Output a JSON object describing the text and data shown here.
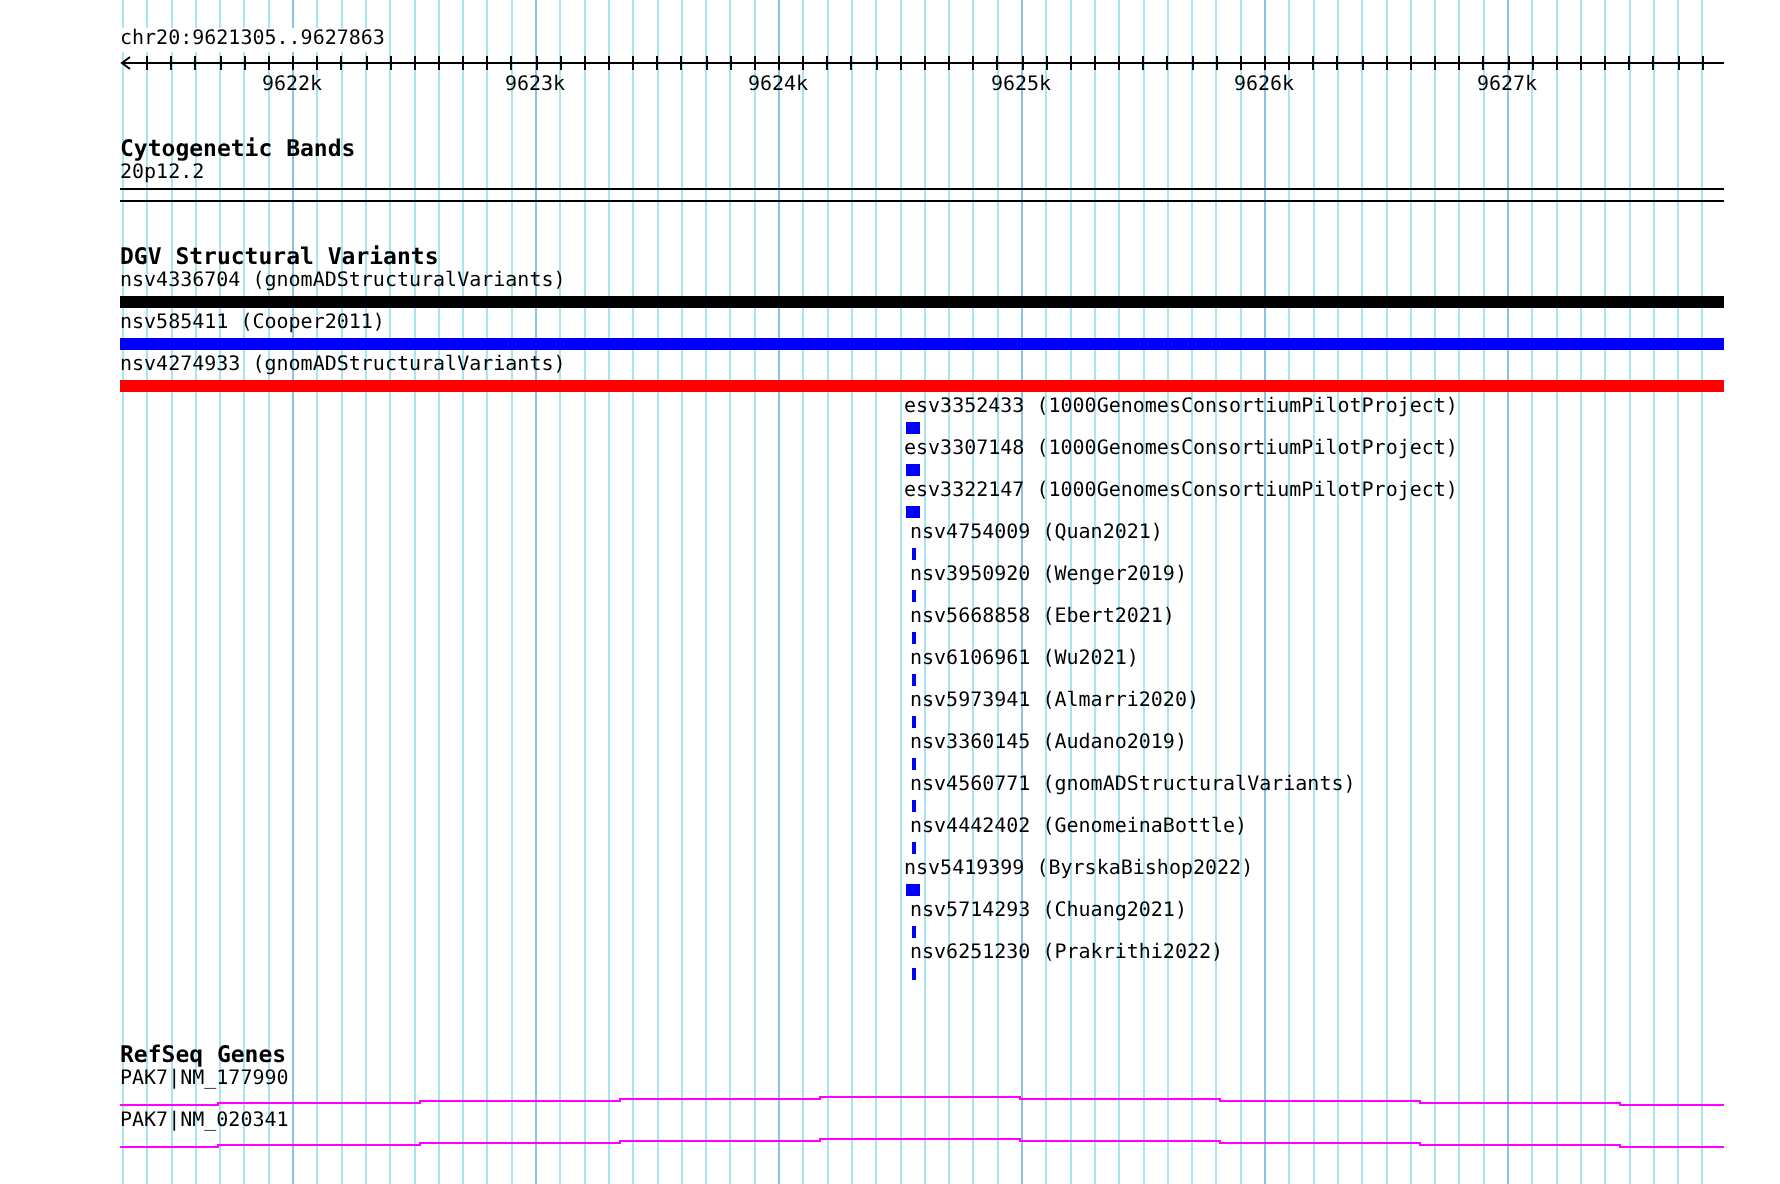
{
  "ruler": {
    "location": "chr20:9621305..9627863",
    "ticks": [
      "9622k",
      "9623k",
      "9624k",
      "9625k",
      "9626k",
      "9627k"
    ]
  },
  "tracks": [
    {
      "title": "Cytogenetic Bands",
      "kind": "band",
      "features": [
        {
          "label": "20p12.2"
        }
      ]
    },
    {
      "title": "DGV Structural Variants",
      "kind": "variants",
      "features": [
        {
          "label": "nsv4336704 (gnomADStructuralVariants)",
          "kind": "span",
          "color": "#000000"
        },
        {
          "label": "nsv585411 (Cooper2011)",
          "kind": "span",
          "color": "#0000ff"
        },
        {
          "label": "nsv4274933 (gnomADStructuralVariants)",
          "kind": "span",
          "color": "#ff0000"
        },
        {
          "label": "esv3352433 (1000GenomesConsortiumPilotProject)",
          "kind": "block",
          "color": "#0000ff"
        },
        {
          "label": "esv3307148 (1000GenomesConsortiumPilotProject)",
          "kind": "block",
          "color": "#0000ff"
        },
        {
          "label": "esv3322147 (1000GenomesConsortiumPilotProject)",
          "kind": "block",
          "color": "#0000ff"
        },
        {
          "label": "nsv4754009 (Quan2021)",
          "kind": "tick",
          "color": "#0000ff"
        },
        {
          "label": "nsv3950920 (Wenger2019)",
          "kind": "tick",
          "color": "#0000ff"
        },
        {
          "label": "nsv5668858 (Ebert2021)",
          "kind": "tick",
          "color": "#0000ff"
        },
        {
          "label": "nsv6106961 (Wu2021)",
          "kind": "tick",
          "color": "#0000ff"
        },
        {
          "label": "nsv5973941 (Almarri2020)",
          "kind": "tick",
          "color": "#0000ff"
        },
        {
          "label": "nsv3360145 (Audano2019)",
          "kind": "tick",
          "color": "#0000ff"
        },
        {
          "label": "nsv4560771 (gnomADStructuralVariants)",
          "kind": "tick",
          "color": "#0000ff"
        },
        {
          "label": "nsv4442402 (GenomeinaBottle)",
          "kind": "tick",
          "color": "#0000ff"
        },
        {
          "label": "nsv5419399 (ByrskaBishop2022)",
          "kind": "block",
          "color": "#0000ff"
        },
        {
          "label": "nsv5714293 (Chuang2021)",
          "kind": "tick",
          "color": "#0000ff"
        },
        {
          "label": "nsv6251230 (Prakrithi2022)",
          "kind": "tick",
          "color": "#0000ff"
        }
      ]
    },
    {
      "title": "RefSeq Genes",
      "kind": "genes",
      "features": [
        {
          "label": "PAK7|NM_177990"
        },
        {
          "label": "PAK7|NM_020341"
        }
      ]
    }
  ]
}
